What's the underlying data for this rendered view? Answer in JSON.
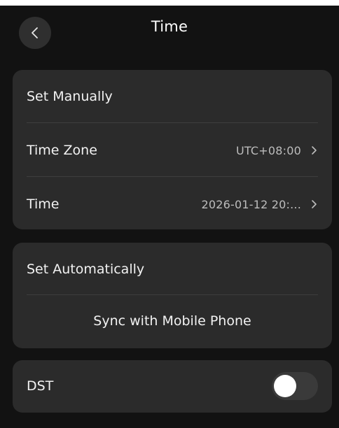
{
  "header": {
    "title": "Time",
    "back_icon": "chevron-left-icon"
  },
  "manual": {
    "set_manually_label": "Set Manually",
    "time_zone_label": "Time Zone",
    "time_zone_value": "UTC+08:00",
    "time_label": "Time",
    "time_value": "2026-01-12 20:..."
  },
  "automatic": {
    "set_automatically_label": "Set Automatically",
    "sync_label": "Sync with Mobile Phone"
  },
  "dst": {
    "label": "DST",
    "enabled": false
  },
  "colors": {
    "background": "#121212",
    "card": "#2b2b2b",
    "toggle_off": "#3a3a3a"
  }
}
